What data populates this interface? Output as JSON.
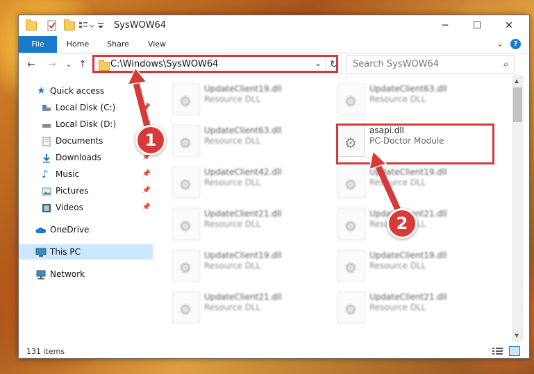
{
  "window": {
    "title": "SysWOW64",
    "controls": {
      "minimize": "─",
      "maximize": "☐",
      "close": "✕"
    }
  },
  "ribbon": {
    "tabs": [
      "File",
      "Home",
      "Share",
      "View"
    ],
    "collapse": "⌄",
    "help": "?"
  },
  "nav": {
    "back": "←",
    "forward": "→",
    "recent": "⌄",
    "up": "↑"
  },
  "address": {
    "path": "C:\\Windows\\SysWOW64",
    "dropdown": "⌄",
    "refresh": "↻"
  },
  "search": {
    "placeholder": "Search SysWOW64",
    "icon": "⌕"
  },
  "sidebar": {
    "items": [
      {
        "label": "Quick access",
        "icon": "star-icon"
      },
      {
        "label": "Local Disk (C:)",
        "icon": "drive-icon"
      },
      {
        "label": "Local Disk (D:)",
        "icon": "drive-icon"
      },
      {
        "label": "Documents",
        "icon": "documents-icon"
      },
      {
        "label": "Downloads",
        "icon": "download-icon"
      },
      {
        "label": "Music",
        "icon": "music-icon"
      },
      {
        "label": "Pictures",
        "icon": "pictures-icon"
      },
      {
        "label": "Videos",
        "icon": "videos-icon"
      },
      {
        "label": "OneDrive",
        "icon": "cloud-icon"
      },
      {
        "label": "This PC",
        "icon": "computer-icon"
      },
      {
        "label": "Network",
        "icon": "network-icon"
      }
    ]
  },
  "files": [
    {
      "name": "UpdateClient19.dll",
      "desc": "Resource DLL"
    },
    {
      "name": "UpdateClient63.dll",
      "desc": "Resource DLL"
    },
    {
      "name": "UpdateClient63.dll",
      "desc": "Resource DLL"
    },
    {
      "name": "asapi.dll",
      "desc": "PC-Doctor Module"
    },
    {
      "name": "UpdateClient42.dll",
      "desc": "Resource DLL"
    },
    {
      "name": "UpdateClient19.dll",
      "desc": "Resource DLL"
    },
    {
      "name": "UpdateClient21.dll",
      "desc": "Resource DLL"
    },
    {
      "name": "UpdateClient21.dll",
      "desc": "Resource DLL"
    },
    {
      "name": "UpdateClient19.dll",
      "desc": "Resource DLL"
    },
    {
      "name": "UpdateClient19.dll",
      "desc": "Resource DLL"
    },
    {
      "name": "UpdateClient21.dll",
      "desc": "Resource DLL"
    },
    {
      "name": "UpdateClient21.dll",
      "desc": "Resource DLL"
    }
  ],
  "status": {
    "count": "131 items"
  },
  "callouts": [
    "1",
    "2"
  ],
  "colors": {
    "accent": "#1979ca",
    "highlight": "#d23a3a",
    "selected": "#cce8ff"
  }
}
